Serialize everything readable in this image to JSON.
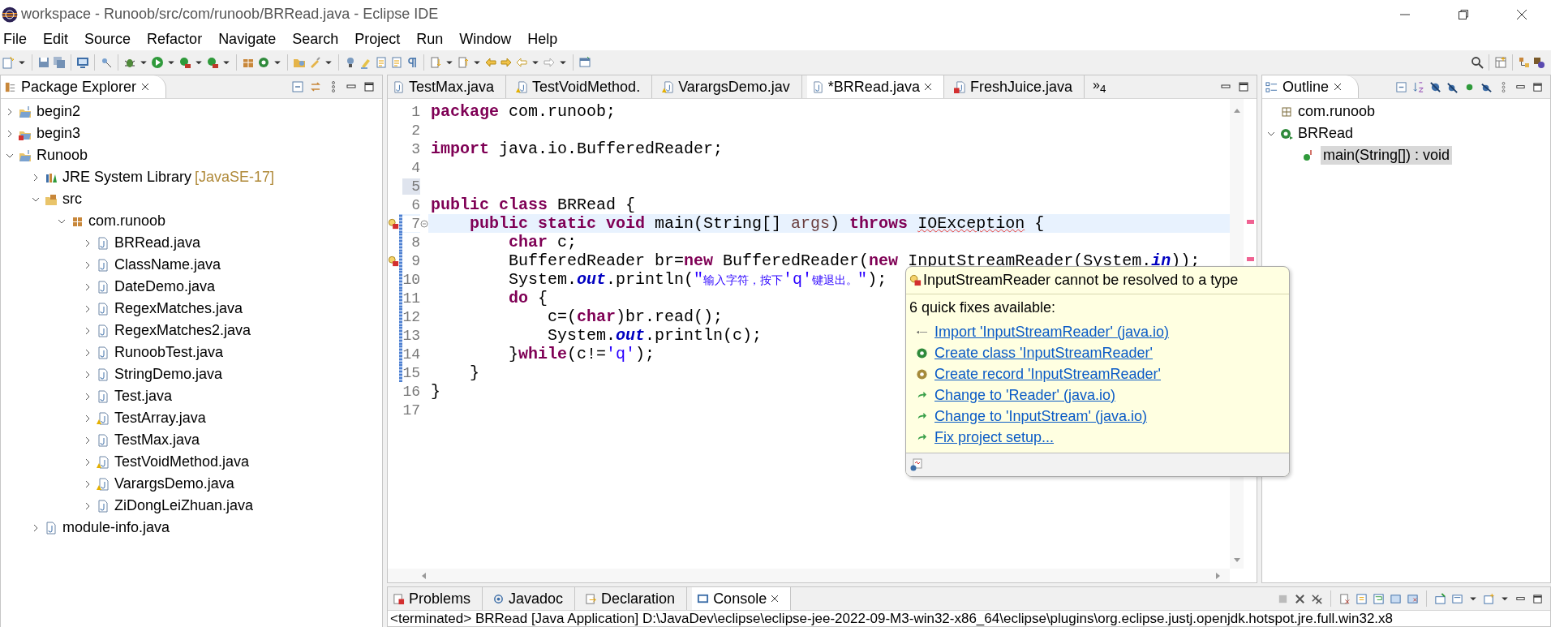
{
  "window": {
    "title": "workspace - Runoob/src/com/runoob/BRRead.java - Eclipse IDE"
  },
  "menu": [
    "File",
    "Edit",
    "Source",
    "Refactor",
    "Navigate",
    "Search",
    "Project",
    "Run",
    "Window",
    "Help"
  ],
  "explorer": {
    "title": "Package Explorer",
    "items": [
      {
        "label": "begin2",
        "kind": "project",
        "expanded": false
      },
      {
        "label": "begin3",
        "kind": "project-error",
        "expanded": false
      },
      {
        "label": "Runoob",
        "kind": "project",
        "expanded": true,
        "children": [
          {
            "label": "JRE System Library",
            "detail": "[JavaSE-17]",
            "kind": "library",
            "expanded": false
          },
          {
            "label": "src",
            "kind": "source-folder",
            "expanded": true,
            "children": [
              {
                "label": "com.runoob",
                "kind": "package",
                "expanded": true,
                "children": [
                  {
                    "label": "BRRead.java",
                    "kind": "java",
                    "expanded": false
                  },
                  {
                    "label": "ClassName.java",
                    "kind": "java",
                    "expanded": false
                  },
                  {
                    "label": "DateDemo.java",
                    "kind": "java",
                    "expanded": false
                  },
                  {
                    "label": "RegexMatches.java",
                    "kind": "java",
                    "expanded": false
                  },
                  {
                    "label": "RegexMatches2.java",
                    "kind": "java",
                    "expanded": false
                  },
                  {
                    "label": "RunoobTest.java",
                    "kind": "java",
                    "expanded": false
                  },
                  {
                    "label": "StringDemo.java",
                    "kind": "java",
                    "expanded": false
                  },
                  {
                    "label": "Test.java",
                    "kind": "java",
                    "expanded": false
                  },
                  {
                    "label": "TestArray.java",
                    "kind": "java-warning",
                    "expanded": false
                  },
                  {
                    "label": "TestMax.java",
                    "kind": "java",
                    "expanded": false
                  },
                  {
                    "label": "TestVoidMethod.java",
                    "kind": "java-warning",
                    "expanded": false
                  },
                  {
                    "label": "VarargsDemo.java",
                    "kind": "java-warning",
                    "expanded": false
                  },
                  {
                    "label": "ZiDongLeiZhuan.java",
                    "kind": "java",
                    "expanded": false
                  }
                ]
              }
            ]
          },
          {
            "label": "module-info.java",
            "kind": "java",
            "expanded": false
          }
        ]
      }
    ]
  },
  "editor": {
    "tabs": [
      {
        "label": "TestMax.java",
        "kind": "java",
        "selected": false
      },
      {
        "label": "TestVoidMethod.",
        "kind": "java-warning",
        "selected": false
      },
      {
        "label": "VarargsDemo.jav",
        "kind": "java-warning",
        "selected": false
      },
      {
        "label": "*BRRead.java",
        "kind": "java",
        "selected": true
      },
      {
        "label": "FreshJuice.java",
        "kind": "java-error",
        "selected": false
      }
    ],
    "overflow": "»$_{4}$",
    "lines": [
      {
        "number": "1",
        "error": false,
        "current": false,
        "changed": false,
        "caret": false,
        "tokens": [
          {
            "kind": "keyword",
            "text": "package"
          },
          {
            "kind": "plain",
            "text": " com.runoob;"
          }
        ]
      },
      {
        "number": "2",
        "error": false,
        "current": false,
        "changed": false,
        "caret": false
      },
      {
        "number": "3",
        "error": false,
        "current": false,
        "changed": false,
        "caret": false,
        "tokens": [
          {
            "kind": "keyword",
            "text": "import"
          },
          {
            "kind": "plain",
            "text": " java.io.BufferedReader;"
          }
        ]
      },
      {
        "number": "4",
        "error": false,
        "current": false,
        "changed": false,
        "caret": false
      },
      {
        "number": "5",
        "error": false,
        "current": false,
        "changed": false,
        "caret": true
      },
      {
        "number": "6",
        "error": false,
        "current": false,
        "changed": false,
        "caret": false,
        "tokens": [
          {
            "kind": "keyword",
            "text": "public class"
          },
          {
            "kind": "plain",
            "text": " BRRead {"
          }
        ]
      },
      {
        "number": "7",
        "error": true,
        "current": true,
        "changed": true,
        "caret": false,
        "fold": true,
        "tokens": [
          {
            "kind": "keyword",
            "text": "    public static void"
          },
          {
            "kind": "plain",
            "text": " main(String[] "
          },
          {
            "kind": "param",
            "text": "args"
          },
          {
            "kind": "plain",
            "text": ") "
          },
          {
            "kind": "keyword",
            "text": "throws "
          },
          {
            "kind": "error",
            "text": "IOException"
          },
          {
            "kind": "plain",
            "text": " {"
          }
        ]
      },
      {
        "number": "8",
        "error": false,
        "current": false,
        "changed": true,
        "caret": false,
        "tokens": [
          {
            "kind": "keyword",
            "text": "        char"
          },
          {
            "kind": "plain",
            "text": " c;"
          }
        ]
      },
      {
        "number": "9",
        "error": true,
        "current": false,
        "changed": true,
        "caret": false,
        "tokens": [
          {
            "kind": "plain",
            "text": "        BufferedReader br="
          },
          {
            "kind": "keyword",
            "text": "new"
          },
          {
            "kind": "plain",
            "text": " BufferedReader("
          },
          {
            "kind": "keyword",
            "text": "new "
          },
          {
            "kind": "error",
            "text": "InputStreamReader"
          },
          {
            "kind": "plain",
            "text": "(System."
          },
          {
            "kind": "field",
            "text": "in"
          },
          {
            "kind": "plain",
            "text": "));"
          }
        ]
      },
      {
        "number": "10",
        "error": false,
        "current": false,
        "changed": true,
        "caret": false,
        "tokens": [
          {
            "kind": "plain",
            "text": "        System."
          },
          {
            "kind": "field",
            "text": "out"
          },
          {
            "kind": "plain",
            "text": ".println("
          },
          {
            "kind": "string",
            "text": "\"输入字符，按下'q'键退出。\""
          },
          {
            "kind": "plain",
            "text": ");"
          }
        ]
      },
      {
        "number": "11",
        "error": false,
        "current": false,
        "changed": true,
        "caret": false,
        "tokens": [
          {
            "kind": "keyword",
            "text": "        do"
          },
          {
            "kind": "plain",
            "text": " {"
          }
        ]
      },
      {
        "number": "12",
        "error": false,
        "current": false,
        "changed": true,
        "caret": false,
        "tokens": [
          {
            "kind": "plain",
            "text": "            c=("
          },
          {
            "kind": "keyword",
            "text": "char"
          },
          {
            "kind": "plain",
            "text": ")br.read();"
          }
        ]
      },
      {
        "number": "13",
        "error": false,
        "current": false,
        "changed": true,
        "caret": false,
        "tokens": [
          {
            "kind": "plain",
            "text": "            System."
          },
          {
            "kind": "field",
            "text": "out"
          },
          {
            "kind": "plain",
            "text": ".println(c);"
          }
        ]
      },
      {
        "number": "14",
        "error": false,
        "current": false,
        "changed": true,
        "caret": false,
        "tokens": [
          {
            "kind": "plain",
            "text": "        }"
          },
          {
            "kind": "keyword",
            "text": "while"
          },
          {
            "kind": "plain",
            "text": "(c!="
          },
          {
            "kind": "string",
            "text": "'q'"
          },
          {
            "kind": "plain",
            "text": ");"
          }
        ]
      },
      {
        "number": "15",
        "error": false,
        "current": false,
        "changed": true,
        "caret": false,
        "tokens": [
          {
            "kind": "plain",
            "text": "    }"
          }
        ]
      },
      {
        "number": "16",
        "error": false,
        "current": false,
        "changed": false,
        "caret": false,
        "tokens": [
          {
            "kind": "plain",
            "text": "}"
          }
        ]
      },
      {
        "number": "17",
        "error": false,
        "current": false,
        "changed": false,
        "caret": false
      }
    ]
  },
  "quick_fix": {
    "title": "InputStreamReader cannot be resolved to a type",
    "subtitle": "6 quick fixes available:",
    "fixes": [
      {
        "kind": "import",
        "label": "Import 'InputStreamReader' (java.io)"
      },
      {
        "kind": "class",
        "label": "Create class 'InputStreamReader'"
      },
      {
        "kind": "record",
        "label": "Create record 'InputStreamReader'"
      },
      {
        "kind": "change",
        "label": "Change to 'Reader' (java.io)"
      },
      {
        "kind": "change",
        "label": "Change to 'InputStream' (java.io)"
      },
      {
        "kind": "change",
        "label": "Fix project setup..."
      }
    ]
  },
  "outline": {
    "title": "Outline",
    "items": [
      {
        "label": "com.runoob",
        "kind": "imports",
        "selected": false
      },
      {
        "label": "BRRead",
        "kind": "class",
        "selected": false,
        "expanded": true,
        "children": [
          {
            "label": "main(String[]) : void",
            "kind": "method",
            "selected": true
          }
        ]
      }
    ]
  },
  "bottom_panel": {
    "tabs": [
      {
        "label": "Problems",
        "kind": "problems",
        "selected": false
      },
      {
        "label": "Javadoc",
        "kind": "javadoc",
        "selected": false
      },
      {
        "label": "Declaration",
        "kind": "declaration",
        "selected": false
      },
      {
        "label": "Console",
        "kind": "console",
        "selected": true
      }
    ],
    "console": "<terminated> BRRead [Java Application] D:\\JavaDev\\eclipse\\eclipse-jee-2022-09-M3-win32-x86_64\\eclipse\\plugins\\org.eclipse.justj.openjdk.hotspot.jre.full.win32.x8"
  }
}
